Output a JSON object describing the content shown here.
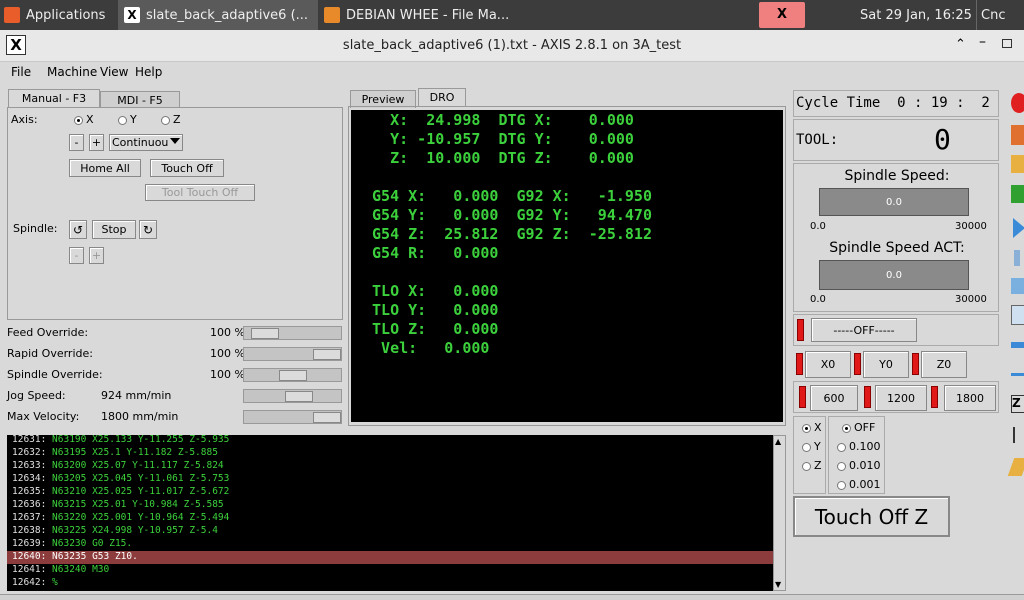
{
  "taskbar": {
    "apps_label": "Applications",
    "win1": "slate_back_adaptive6 (...",
    "win2": "DEBIAN WHEE - File Ma...",
    "clock": "Sat 29 Jan, 16:25",
    "tray_label": "Cnc"
  },
  "window": {
    "title": "slate_back_adaptive6 (1).txt - AXIS 2.8.1 on 3A_test"
  },
  "menu": {
    "file": "File",
    "machine": "Machine",
    "view": "View",
    "help": "Help"
  },
  "left_tabs": {
    "manual": "Manual - F3",
    "mdi": "MDI - F5"
  },
  "manual": {
    "axis_label": "Axis:",
    "axis_x": "X",
    "axis_y": "Y",
    "axis_z": "Z",
    "minus": "-",
    "plus": "+",
    "jog_mode": "Continuou",
    "home_all": "Home All",
    "touch_off": "Touch Off",
    "tool_touch_off": "Tool Touch Off",
    "spindle_label": "Spindle:",
    "spindle_stop": "Stop"
  },
  "overrides": [
    {
      "label": "Feed Override:",
      "value": "100 %",
      "level": 0.1
    },
    {
      "label": "Rapid Override:",
      "value": "100 %",
      "level": 1.0
    },
    {
      "label": "Spindle Override:",
      "value": "100 %",
      "level": 0.5
    },
    {
      "label": "Jog Speed:",
      "value": "924 mm/min",
      "level": 0.6
    },
    {
      "label": "Max Velocity:",
      "value": "1800 mm/min",
      "level": 1.0
    }
  ],
  "view_tabs": {
    "preview": "Preview",
    "dro": "DRO"
  },
  "dro": [
    "   X:  24.998  DTG X:    0.000",
    "   Y: -10.957  DTG Y:    0.000",
    "   Z:  10.000  DTG Z:    0.000",
    "",
    " G54 X:   0.000  G92 X:   -1.950",
    " G54 Y:   0.000  G92 Y:   94.470",
    " G54 Z:  25.812  G92 Z:  -25.812",
    " G54 R:   0.000",
    "",
    " TLO X:   0.000",
    " TLO Y:   0.000",
    " TLO Z:   0.000",
    "  Vel:   0.000"
  ],
  "gcode": [
    {
      "ln": "12631:",
      "code": " N63190 X25.133 Y-11.255 Z-5.935",
      "hl": false
    },
    {
      "ln": "12632:",
      "code": " N63195 X25.1 Y-11.182 Z-5.885",
      "hl": false
    },
    {
      "ln": "12633:",
      "code": " N63200 X25.07 Y-11.117 Z-5.824",
      "hl": false
    },
    {
      "ln": "12634:",
      "code": " N63205 X25.045 Y-11.061 Z-5.753",
      "hl": false
    },
    {
      "ln": "12635:",
      "code": " N63210 X25.025 Y-11.017 Z-5.672",
      "hl": false
    },
    {
      "ln": "12636:",
      "code": " N63215 X25.01 Y-10.984 Z-5.585",
      "hl": false
    },
    {
      "ln": "12637:",
      "code": " N63220 X25.001 Y-10.964 Z-5.494",
      "hl": false
    },
    {
      "ln": "12638:",
      "code": " N63225 X24.998 Y-10.957 Z-5.4",
      "hl": false
    },
    {
      "ln": "12639:",
      "code": " N63230 G0 Z15.",
      "hl": false
    },
    {
      "ln": "12640:",
      "code": " N63235 G53 Z10.",
      "hl": true
    },
    {
      "ln": "12641:",
      "code": " N63240 M30",
      "hl": false
    },
    {
      "ln": "12642:",
      "code": " %",
      "hl": false
    }
  ],
  "right": {
    "cycle_time": "Cycle Time  0 : 19 :  2",
    "tool_label": "TOOL:",
    "tool_value": "0",
    "spindle_speed_label": "Spindle Speed:",
    "spindle_speed_value": "0.0",
    "scale_min": "0.0",
    "scale_max": "30000",
    "spindle_act_label": "Spindle Speed ACT:",
    "spindle_act_value": "0.0",
    "off_button": "-----OFF-----",
    "x0": "X0",
    "y0": "Y0",
    "z0": "Z0",
    "f600": "600",
    "f1200": "1200",
    "f1800": "1800",
    "axis_x": "X",
    "axis_y": "Y",
    "axis_z": "Z",
    "inc_off": "OFF",
    "inc_1": "0.100",
    "inc_2": "0.010",
    "inc_3": "0.001",
    "touch_off_z": "Touch Off Z"
  },
  "colors": {
    "dro_text": "#3cd13c",
    "highlight": "#8c3c3c",
    "red_led": "#e01818"
  }
}
